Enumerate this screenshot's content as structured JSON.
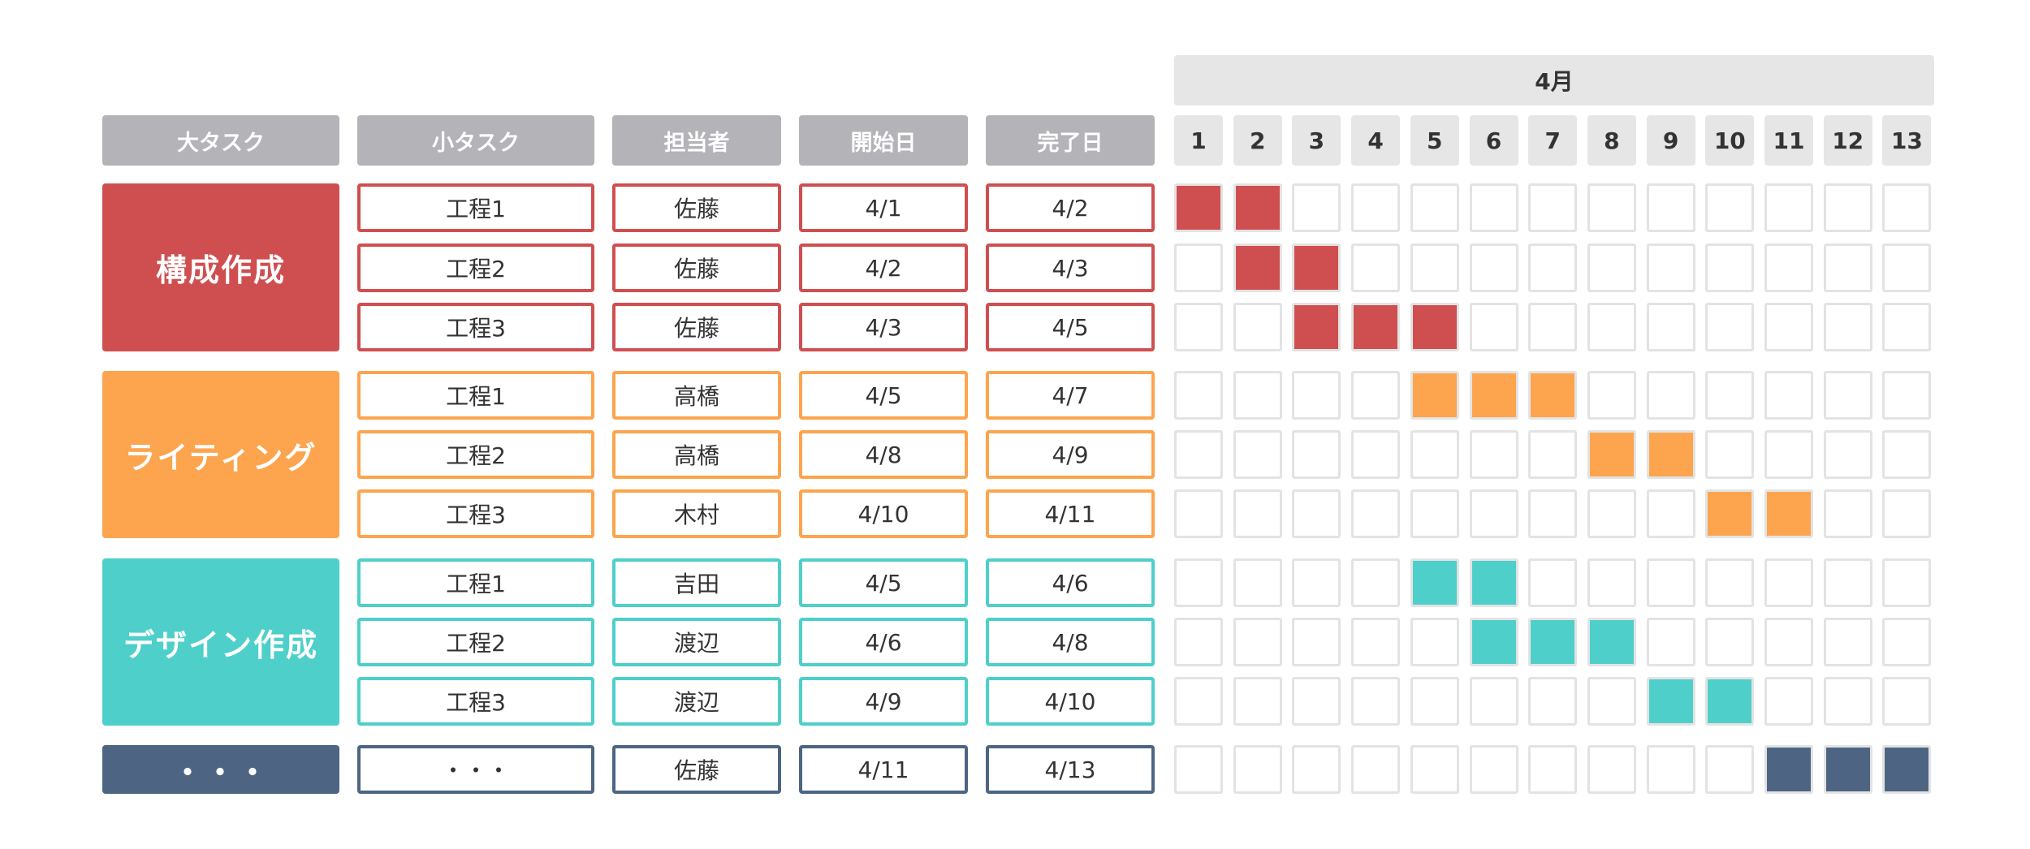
{
  "month_label": "4月",
  "headers": {
    "major": "大タスク",
    "minor": "小タスク",
    "owner": "担当者",
    "start": "開始日",
    "end": "完了日"
  },
  "days": [
    "1",
    "2",
    "3",
    "4",
    "5",
    "6",
    "7",
    "8",
    "9",
    "10",
    "11",
    "12",
    "13"
  ],
  "groups": [
    {
      "label": "構成作成",
      "color": "#cf4f51",
      "tasks": [
        {
          "name": "工程1",
          "owner": "佐藤",
          "start": "4/1",
          "end": "4/2",
          "from": 1,
          "to": 2
        },
        {
          "name": "工程2",
          "owner": "佐藤",
          "start": "4/2",
          "end": "4/3",
          "from": 2,
          "to": 3
        },
        {
          "name": "工程3",
          "owner": "佐藤",
          "start": "4/3",
          "end": "4/5",
          "from": 3,
          "to": 5
        }
      ]
    },
    {
      "label": "ライティング",
      "color": "#fda44e",
      "tasks": [
        {
          "name": "工程1",
          "owner": "高橋",
          "start": "4/5",
          "end": "4/7",
          "from": 5,
          "to": 7
        },
        {
          "name": "工程2",
          "owner": "高橋",
          "start": "4/8",
          "end": "4/9",
          "from": 8,
          "to": 9
        },
        {
          "name": "工程3",
          "owner": "木村",
          "start": "4/10",
          "end": "4/11",
          "from": 10,
          "to": 11
        }
      ]
    },
    {
      "label": "デザイン作成",
      "color": "#4ecfca",
      "tasks": [
        {
          "name": "工程1",
          "owner": "吉田",
          "start": "4/5",
          "end": "4/6",
          "from": 5,
          "to": 6
        },
        {
          "name": "工程2",
          "owner": "渡辺",
          "start": "4/6",
          "end": "4/8",
          "from": 6,
          "to": 8
        },
        {
          "name": "工程3",
          "owner": "渡辺",
          "start": "4/9",
          "end": "4/10",
          "from": 9,
          "to": 10
        }
      ]
    },
    {
      "label": "・・・",
      "color": "#4d6583",
      "tasks": [
        {
          "name": "・・・",
          "owner": "佐藤",
          "start": "4/11",
          "end": "4/13",
          "from": 11,
          "to": 13
        }
      ]
    }
  ]
}
